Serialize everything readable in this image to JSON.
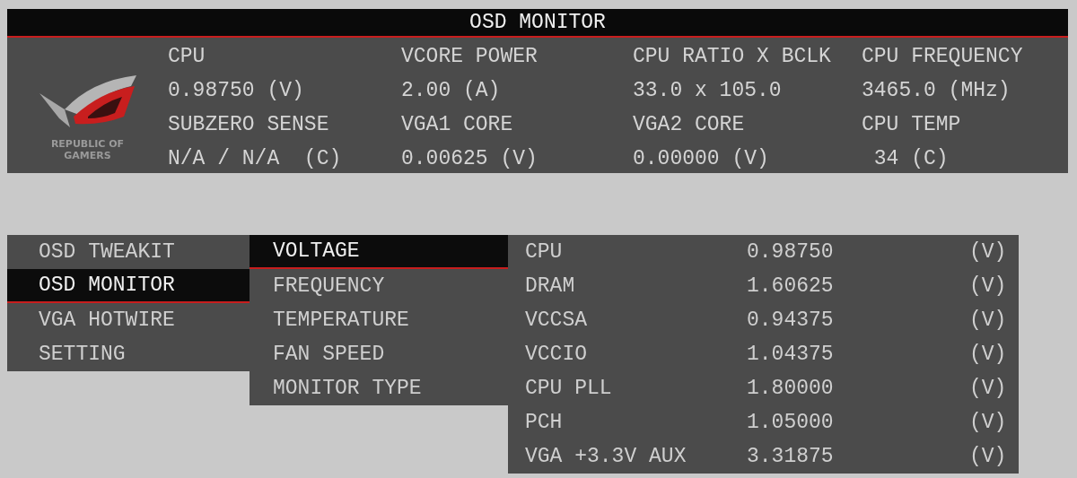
{
  "header": {
    "title": "OSD MONITOR",
    "logo_text": [
      "REPUBLIC OF",
      "GAMERS"
    ],
    "readings": [
      {
        "label": "CPU",
        "value": "0.98750 (V)"
      },
      {
        "label": "VCORE POWER",
        "value": "2.00 (A)"
      },
      {
        "label": "CPU RATIO X BCLK",
        "value": "33.0 x 105.0"
      },
      {
        "label": "CPU FREQUENCY",
        "value": "3465.0 (MHz)"
      },
      {
        "label": "SUBZERO SENSE",
        "value": "N/A / N/A  (C)"
      },
      {
        "label": "VGA1 CORE",
        "value": "0.00625 (V)"
      },
      {
        "label": "VGA2 CORE",
        "value": "0.00000 (V)"
      },
      {
        "label": "CPU TEMP",
        "value": " 34 (C)"
      }
    ]
  },
  "main_menu": [
    {
      "label": "OSD TWEAKIT",
      "selected": false
    },
    {
      "label": "OSD MONITOR",
      "selected": true
    },
    {
      "label": "VGA HOTWIRE",
      "selected": false
    },
    {
      "label": "SETTING",
      "selected": false
    }
  ],
  "sub_menu": [
    {
      "label": "VOLTAGE",
      "selected": true
    },
    {
      "label": "FREQUENCY",
      "selected": false
    },
    {
      "label": "TEMPERATURE",
      "selected": false
    },
    {
      "label": "FAN SPEED",
      "selected": false
    },
    {
      "label": "MONITOR TYPE",
      "selected": false
    }
  ],
  "voltages": [
    {
      "name": "CPU",
      "value": "0.98750",
      "unit": "(V)"
    },
    {
      "name": "DRAM",
      "value": "1.60625",
      "unit": "(V)"
    },
    {
      "name": "VCCSA",
      "value": "0.94375",
      "unit": "(V)"
    },
    {
      "name": "VCCIO",
      "value": "1.04375",
      "unit": "(V)"
    },
    {
      "name": "CPU PLL",
      "value": "1.80000",
      "unit": "(V)"
    },
    {
      "name": "PCH",
      "value": "1.05000",
      "unit": "(V)"
    },
    {
      "name": "VGA +3.3V AUX",
      "value": "3.31875",
      "unit": "(V)"
    }
  ]
}
